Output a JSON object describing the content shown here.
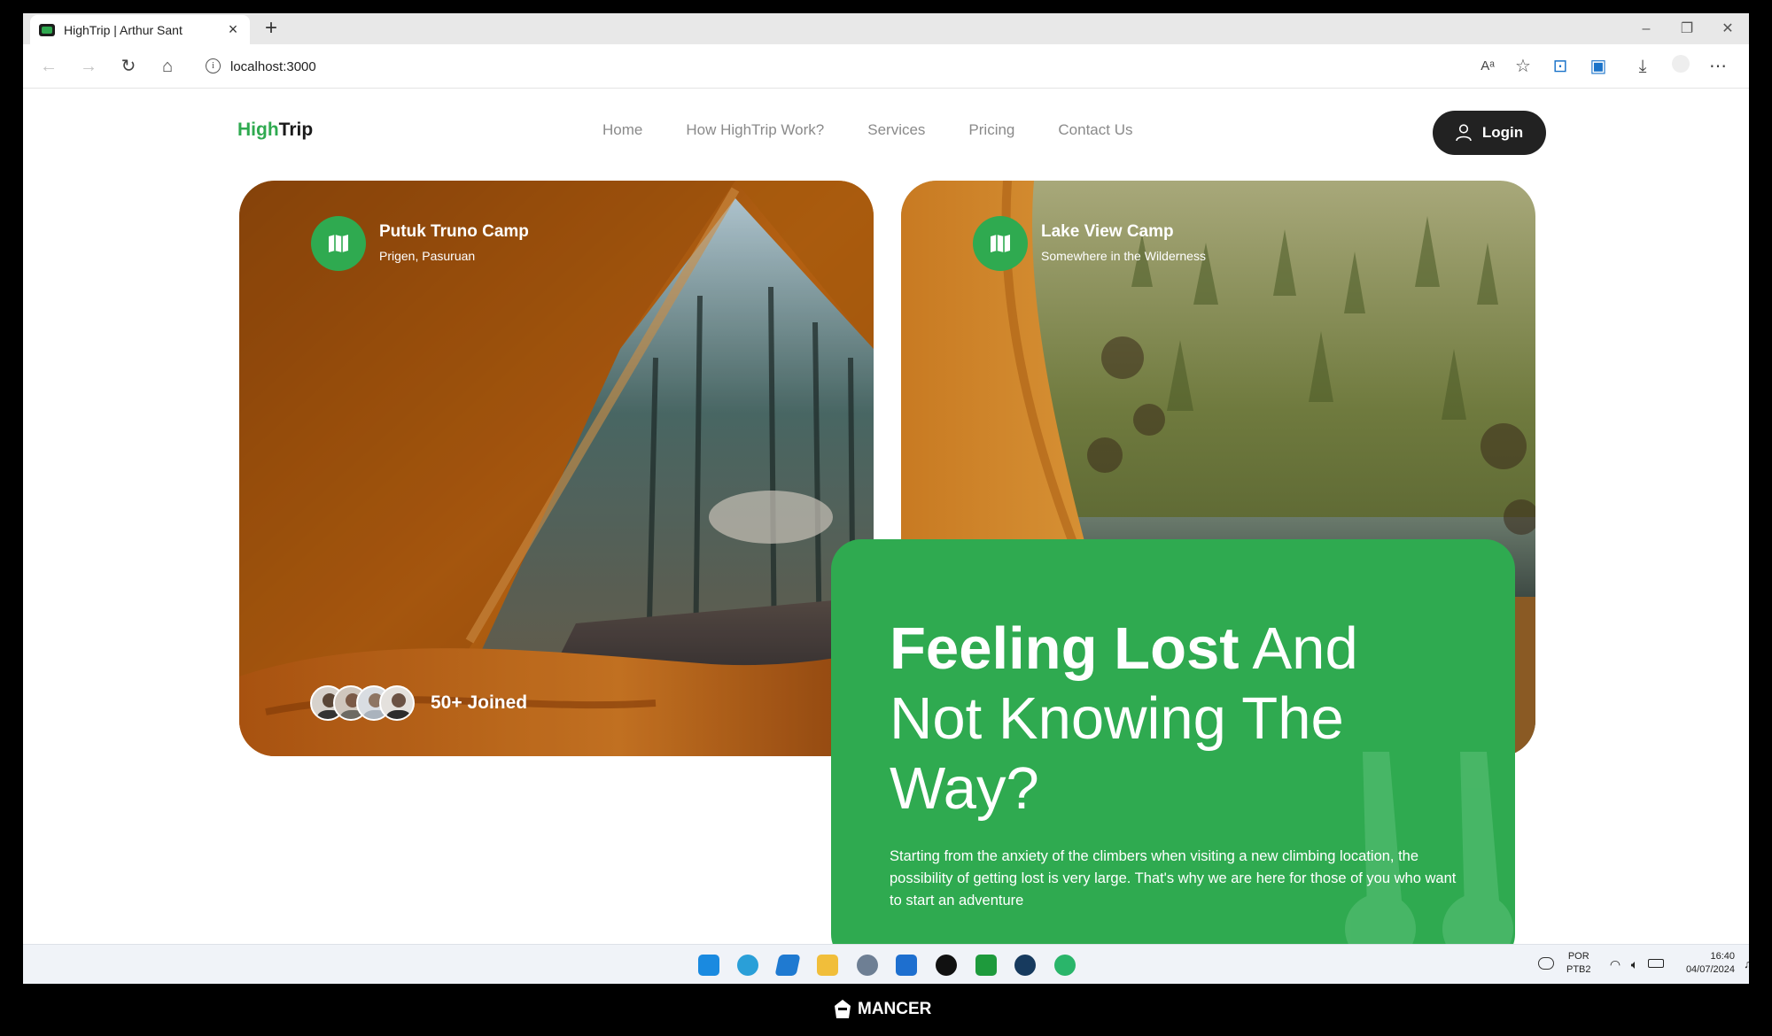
{
  "browser": {
    "tab_title": "HighTrip | Arthur Sant",
    "url": "localhost:3000"
  },
  "site": {
    "logo_high": "High",
    "logo_trip": "Trip",
    "nav": [
      "Home",
      "How HighTrip Work?",
      "Services",
      "Pricing",
      "Contact Us"
    ],
    "login_label": "Login"
  },
  "cards": [
    {
      "title": "Putuk Truno Camp",
      "subtitle": "Prigen, Pasuruan",
      "joined": "50+ Joined"
    },
    {
      "title": "Lake View Camp",
      "subtitle": "Somewhere in the Wilderness"
    }
  ],
  "hero": {
    "headline_strong": "Feeling Lost",
    "headline_rest": " And Not Knowing The Way?",
    "body": "Starting from the anxiety of the climbers when visiting a new climbing location, the possibility of getting lost is very large. That's why we are here for those of you who want to start an adventure"
  },
  "taskbar": {
    "lang_1": "POR",
    "lang_2": "PTB2",
    "time": "16:40",
    "date": "04/07/2024"
  },
  "footer_brand": "MANCER",
  "colors": {
    "accent": "#2faa50",
    "dark": "#222222"
  }
}
